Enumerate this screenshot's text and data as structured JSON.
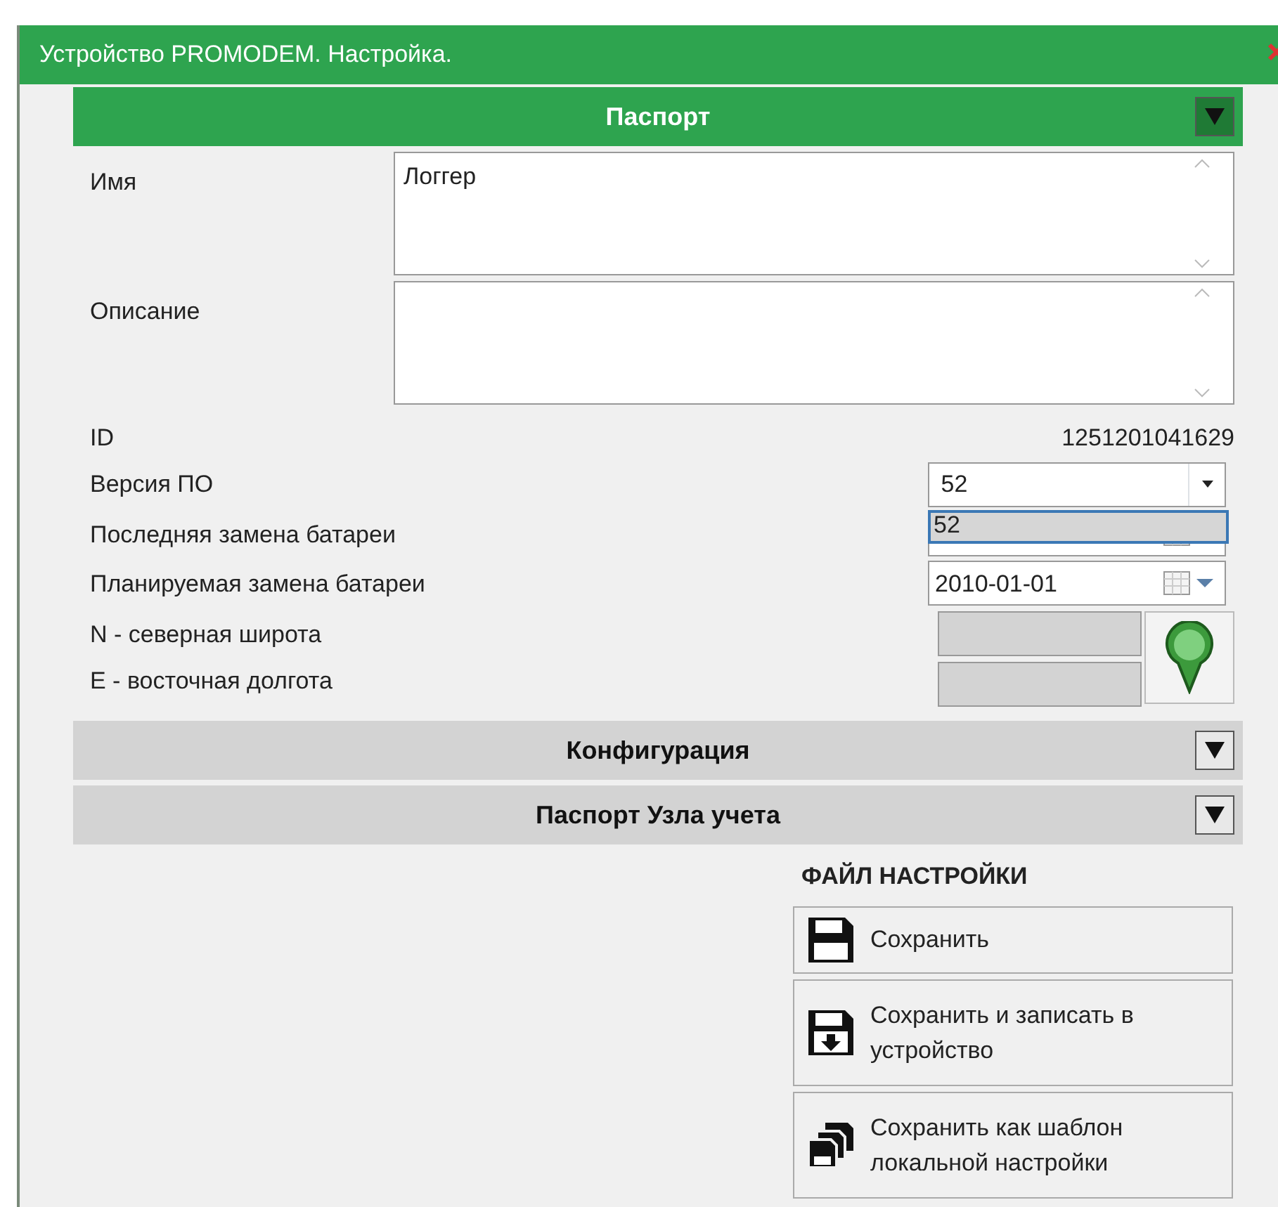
{
  "window": {
    "title": "Устройство PROMODEM. Настройка."
  },
  "sections": [
    {
      "title": "Паспорт",
      "expanded": true
    },
    {
      "title": "Конфигурация",
      "expanded": false
    },
    {
      "title": "Паспорт Узла учета",
      "expanded": false
    }
  ],
  "passport": {
    "name_label": "Имя",
    "name_value": "Логгер",
    "description_label": "Описание",
    "id_label": "ID",
    "id_value": "1251201041629",
    "firmware": {
      "label": "Версия ПО",
      "value": "52",
      "expanded": true,
      "options": [
        {
          "label": "52",
          "selected": true
        }
      ]
    },
    "last_battery": {
      "label": "Последняя замена батареи"
    },
    "planned_battery": {
      "label": "Планируемая замена батареи",
      "value": "2010-01-01"
    },
    "latitude": {
      "label": "N - северная широта",
      "disabled": true
    },
    "longitude": {
      "label": "E - восточная долгота",
      "disabled": true
    }
  },
  "file_settings": {
    "title": "ФАЙЛ НАСТРОЙКИ",
    "buttons": [
      {
        "kind": "save",
        "label": "Сохранить"
      },
      {
        "kind": "write",
        "label": "Сохранить и записать в устройство"
      },
      {
        "kind": "template",
        "label": "Сохранить как шаблон локальной настройки"
      }
    ]
  }
}
